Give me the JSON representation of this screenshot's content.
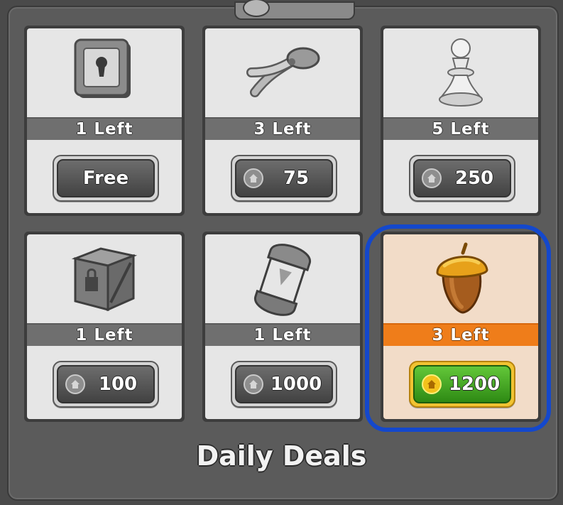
{
  "panel": {
    "title": "Daily Deals"
  },
  "colors": {
    "selected_band": "#ef7d1a",
    "selected_card_bg": "#f2dcc8",
    "buy_button_green": "#3fae24",
    "highlight_outline": "#1448cc"
  },
  "deals": [
    {
      "item_icon": "safe-icon",
      "remaining": "1 Left",
      "price": "Free",
      "currency_icon": null,
      "selected": false
    },
    {
      "item_icon": "pliers-icon",
      "remaining": "3 Left",
      "price": "75",
      "currency_icon": "coin-house-icon",
      "selected": false
    },
    {
      "item_icon": "pawn-icon",
      "remaining": "5 Left",
      "price": "250",
      "currency_icon": "coin-house-icon",
      "selected": false
    },
    {
      "item_icon": "crate-icon",
      "remaining": "1 Left",
      "price": "100",
      "currency_icon": "coin-house-icon",
      "selected": false
    },
    {
      "item_icon": "capsule-icon",
      "remaining": "1 Left",
      "price": "1000",
      "currency_icon": "coin-house-icon",
      "selected": false
    },
    {
      "item_icon": "acorn-icon",
      "remaining": "3 Left",
      "price": "1200",
      "currency_icon": "coin-house-icon",
      "selected": true
    }
  ]
}
